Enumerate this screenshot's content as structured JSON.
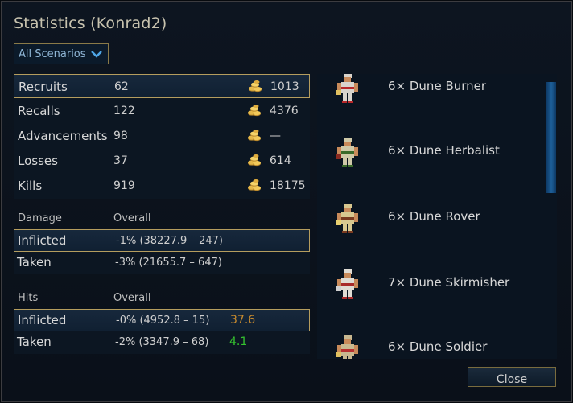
{
  "dialog": {
    "title": "Statistics (Konrad2)",
    "scenario_filter": {
      "selected": "All Scenarios"
    },
    "close_label": "Close"
  },
  "stats": [
    {
      "name": "Recruits",
      "value": "62",
      "cost": "1013",
      "selected": true
    },
    {
      "name": "Recalls",
      "value": "122",
      "cost": "4376",
      "selected": false
    },
    {
      "name": "Advancements",
      "value": "98",
      "cost": "—",
      "selected": false
    },
    {
      "name": "Losses",
      "value": "37",
      "cost": "614",
      "selected": false
    },
    {
      "name": "Kills",
      "value": "919",
      "cost": "18175",
      "selected": false
    }
  ],
  "damage": {
    "header": "Damage",
    "column": "Overall",
    "rows": [
      {
        "name": "Inflicted",
        "value": "-1% (38227.9 – 247)",
        "extra": "",
        "selected": true
      },
      {
        "name": "Taken",
        "value": "-3% (21655.7 – 647)",
        "extra": "",
        "selected": false
      }
    ]
  },
  "hits": {
    "header": "Hits",
    "column": "Overall",
    "rows": [
      {
        "name": "Inflicted",
        "value": "-0% (4952.8 – 15)",
        "extra": "37.6",
        "extra_color": "#c78a2e",
        "selected": true
      },
      {
        "name": "Taken",
        "value": "-2% (3347.9 – 68)",
        "extra": "4.1",
        "extra_color": "#35c22f",
        "selected": false
      }
    ]
  },
  "units": [
    {
      "label": "6× Dune Burner",
      "icon": "dune-burner-sprite"
    },
    {
      "label": "6× Dune Herbalist",
      "icon": "dune-herbalist-sprite"
    },
    {
      "label": "6× Dune Rover",
      "icon": "dune-rover-sprite"
    },
    {
      "label": "7× Dune Skirmisher",
      "icon": "dune-skirmisher-sprite"
    },
    {
      "label": "6× Dune Soldier",
      "icon": "dune-soldier-sprite"
    }
  ],
  "colors": {
    "gold_border": "#b59d5e",
    "scrollbar": "#1d5f99",
    "hit_positive": "#c78a2e",
    "hit_negative": "#35c22f"
  }
}
